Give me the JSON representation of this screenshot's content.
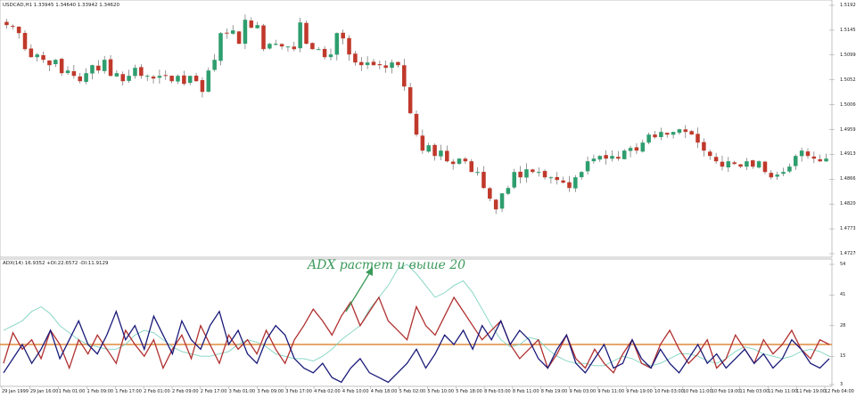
{
  "symbol_title": "USDCAD,H1",
  "ohlc_values": "1.33945 1.34640 1.33942 1.34620",
  "indicator_title": "ADX(14) 16.9352 +DI:22.6572 -DI:11.9129",
  "annotation": "ADX растет и выше 20",
  "price_axis_labels": [
    "1.51920",
    "1.51455",
    "1.50990",
    "1.50525",
    "1.50060",
    "1.49595",
    "1.49130",
    "1.48665",
    "1.48200",
    "1.47735",
    "1.47270"
  ],
  "indicator_axis_labels": [
    "54",
    "41",
    "28",
    "15",
    "3"
  ],
  "time_axis_labels": [
    "29 Jan 1999",
    "29 Jan 16:00",
    "1 Feb 01:00",
    "1 Feb 09:00",
    "1 Feb 17:00",
    "2 Feb 01:00",
    "2 Feb 09:00",
    "2 Feb 17:00",
    "3 Feb 01:00",
    "3 Feb 09:00",
    "3 Feb 17:00",
    "4 Feb 02:00",
    "4 Feb 10:00",
    "4 Feb 18:00",
    "5 Feb 02:00",
    "5 Feb 10:00",
    "5 Feb 18:00",
    "8 Feb 03:00",
    "8 Feb 11:00",
    "8 Feb 19:00",
    "9 Feb 03:00",
    "9 Feb 11:00",
    "9 Feb 19:00",
    "10 Feb 03:00",
    "10 Feb 11:00",
    "10 Feb 19:00",
    "11 Feb 03:00",
    "11 Feb 11:00",
    "11 Feb 19:00",
    "12 Feb 04:00"
  ],
  "colors": {
    "bull": "#2e9e6e",
    "bear": "#c0392b",
    "adx": "#7fd3c0",
    "plus_di": "#b03030",
    "minus_di": "#1a1a7a",
    "level": "#e08a3c",
    "annotation": "#3b9a5a"
  },
  "level_value": 20,
  "chart_data": [
    {
      "type": "candlestick",
      "title": "USDCAD,H1",
      "ylim": [
        1.4727,
        1.5192
      ],
      "close_profile": [
        1.5155,
        1.5152,
        1.514,
        1.511,
        1.5095,
        1.51,
        1.509,
        1.508,
        1.509,
        1.5065,
        1.507,
        1.506,
        1.505,
        1.5065,
        1.508,
        1.507,
        1.509,
        1.506,
        1.5065,
        1.505,
        1.506,
        1.5075,
        1.506,
        1.506,
        1.5055,
        1.506,
        1.506,
        1.505,
        1.506,
        1.5045,
        1.506,
        1.505,
        1.503,
        1.507,
        1.509,
        1.514,
        1.514,
        1.5145,
        1.512,
        1.5165,
        1.515,
        1.5155,
        1.511,
        1.512,
        1.512,
        1.5115,
        1.5115,
        1.511,
        1.516,
        1.512,
        1.511,
        1.511,
        1.5095,
        1.51,
        1.514,
        1.513,
        1.51,
        1.5085,
        1.508,
        1.5085,
        1.508,
        1.508,
        1.5075,
        1.5085,
        1.508,
        1.504,
        1.499,
        1.495,
        1.492,
        1.493,
        1.491,
        1.492,
        1.49,
        1.4895,
        1.4905,
        1.49,
        1.488,
        1.488,
        1.485,
        1.483,
        1.481,
        1.484,
        1.485,
        1.488,
        1.487,
        1.4885,
        1.488,
        1.488,
        1.487,
        1.487,
        1.4865,
        1.486,
        1.485,
        1.487,
        1.488,
        1.49,
        1.4905,
        1.491,
        1.4905,
        1.491,
        1.4905,
        1.492,
        1.4925,
        1.492,
        1.4935,
        1.495,
        1.4945,
        1.4955,
        1.495,
        1.4955,
        1.496,
        1.4955,
        1.495,
        1.4935,
        1.492,
        1.491,
        1.49,
        1.489,
        1.49,
        1.4895,
        1.489,
        1.49,
        1.489,
        1.49,
        1.488,
        1.487,
        1.4875,
        1.488,
        1.489,
        1.491,
        1.492,
        1.491,
        1.4905,
        1.49,
        1.4905
      ],
      "xlabels": "time_axis_labels"
    },
    {
      "type": "line",
      "title": "ADX(14) 16.9352 +DI:22.6572 -DI:11.9129",
      "ylim": [
        3,
        54
      ],
      "series": [
        {
          "name": "ADX",
          "values": [
            26,
            28,
            30,
            34,
            36,
            33,
            28,
            25,
            22,
            20,
            19,
            18,
            18,
            20,
            24,
            26,
            25,
            22,
            19,
            17,
            16,
            15,
            15,
            16,
            17,
            20,
            22,
            21,
            19,
            16,
            15,
            14,
            14,
            13,
            15,
            18,
            22,
            25,
            28,
            35,
            40,
            45,
            52,
            54,
            50,
            45,
            40,
            42,
            45,
            47,
            42,
            35,
            28,
            22,
            19,
            20,
            23,
            22,
            18,
            15,
            13,
            12,
            12,
            11,
            11,
            13,
            15,
            14,
            12,
            11,
            12,
            14,
            16,
            16,
            15,
            13,
            12,
            14,
            17,
            19,
            18,
            16,
            15,
            14,
            15,
            17,
            18,
            17,
            15
          ]
        },
        {
          "name": "+DI",
          "values": [
            12,
            25,
            18,
            22,
            14,
            26,
            20,
            10,
            22,
            16,
            24,
            18,
            12,
            26,
            20,
            15,
            22,
            10,
            18,
            24,
            14,
            28,
            20,
            12,
            24,
            18,
            22,
            16,
            26,
            18,
            12,
            22,
            28,
            35,
            30,
            24,
            32,
            38,
            28,
            34,
            40,
            30,
            26,
            22,
            36,
            28,
            24,
            32,
            40,
            34,
            28,
            22,
            26,
            30,
            20,
            14,
            18,
            22,
            10,
            16,
            24,
            14,
            10,
            18,
            12,
            8,
            16,
            22,
            12,
            10,
            20,
            26,
            18,
            12,
            16,
            22,
            10,
            14,
            24,
            18,
            12,
            22,
            16,
            20,
            26,
            18,
            14,
            22,
            20
          ]
        },
        {
          "name": "-DI",
          "values": [
            8,
            14,
            20,
            12,
            18,
            26,
            14,
            22,
            30,
            20,
            16,
            24,
            34,
            22,
            28,
            18,
            32,
            24,
            16,
            30,
            22,
            18,
            28,
            34,
            20,
            26,
            16,
            12,
            22,
            28,
            24,
            14,
            10,
            8,
            12,
            6,
            4,
            10,
            14,
            8,
            6,
            4,
            8,
            12,
            18,
            10,
            16,
            24,
            20,
            26,
            18,
            28,
            22,
            30,
            20,
            26,
            22,
            14,
            10,
            18,
            24,
            12,
            8,
            14,
            20,
            10,
            12,
            22,
            14,
            10,
            18,
            12,
            8,
            14,
            20,
            12,
            16,
            10,
            14,
            18,
            12,
            16,
            10,
            14,
            22,
            18,
            12,
            10,
            14
          ]
        }
      ]
    }
  ]
}
